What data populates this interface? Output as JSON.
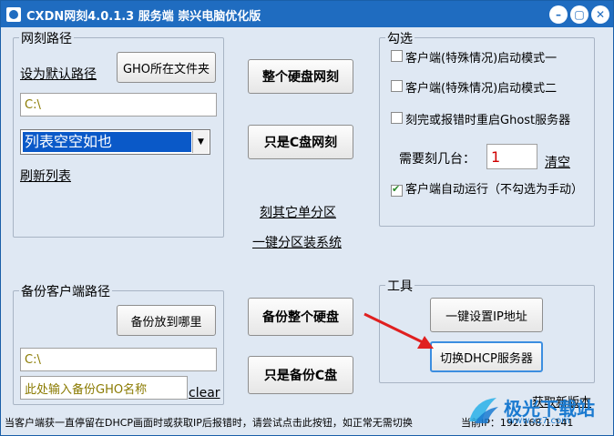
{
  "window": {
    "title": "CXDN网刻4.0.1.3 服务端 崇兴电脑优化版"
  },
  "titlebar_buttons": {
    "minimize": "–",
    "restore": "▢",
    "close": "✕"
  },
  "path_group": {
    "legend": "网刻路径",
    "set_default_link": "设为默认路径",
    "gho_folder_button": "GHO所在文件夹",
    "path_value": "C:\\",
    "list_selected": "列表空空如也",
    "refresh_link": "刷新列表"
  },
  "middle": {
    "whole_disk_button": "整个硬盘网刻",
    "c_only_button": "只是C盘网刻",
    "other_partition_link": "刻其它单分区",
    "one_key_partition_link": "一键分区装系统",
    "backup_disk_button": "备份整个硬盘",
    "backup_c_button": "只是备份C盘"
  },
  "options_group": {
    "legend": "勾选",
    "client_mode1": "客户端(特殊情况)启动模式一",
    "client_mode2": "客户端(特殊情况)启动模式二",
    "restart_ghost": "刻完或报错时重启Ghost服务器",
    "count_label": "需要刻几台：",
    "count_value": "1",
    "clear_link": "清空",
    "auto_run": "客户端自动运行（不勾选为手动）",
    "auto_run_checked": true
  },
  "backup_group": {
    "legend": "备份客户端路径",
    "where_button": "备份放到哪里",
    "path_value": "C:\\",
    "name_placeholder": "此处输入备份GHO名称",
    "clear_link": "clear"
  },
  "tools_group": {
    "legend": "工具",
    "set_ip_button": "一键设置IP地址",
    "switch_dhcp_button": "切换DHCP服务器"
  },
  "update_link": "获取新版本",
  "statusbar": {
    "hint": "当客户端获一直停留在DHCP画面时或获取IP后报错时，请尝试点击此按钮，如正常无需切换",
    "ip_label": "当前IP：",
    "ip_value": "192.168.1.141"
  },
  "watermark": {
    "name": "极光下载站",
    "url": "www.xz7.com"
  },
  "colors": {
    "titlebar": "#1f6cc0",
    "window_bg": "#dfe8f3",
    "selection": "#0a59c8",
    "arrow": "#e02020"
  }
}
